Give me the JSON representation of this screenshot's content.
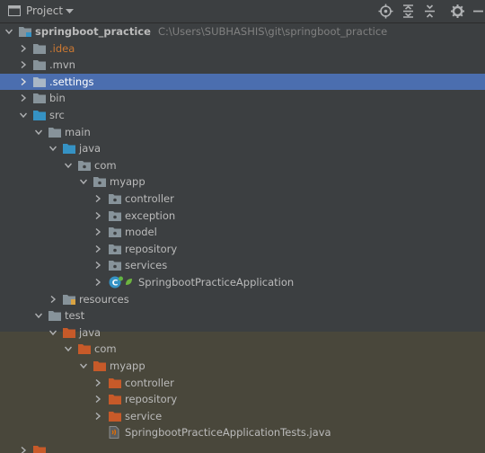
{
  "header": {
    "title": "Project",
    "icons": [
      "project-view-icon",
      "chevron-down-icon",
      "locate-icon",
      "expand-all-icon",
      "collapse-all-icon",
      "gear-icon",
      "hide-icon"
    ]
  },
  "colors": {
    "panel_bg": "#3c3f41",
    "selection": "#4b6eaf",
    "test_bg": "#49473b",
    "folder": "#87939a",
    "source_folder": "#3592c4",
    "test_folder": "#c75a29",
    "excluded_text": "#cc7832"
  },
  "tree": {
    "project": {
      "name": "springboot_practice",
      "path": "C:\\Users\\SUBHASHIS\\git\\springboot_practice"
    },
    "idea": ".idea",
    "mvn": ".mvn",
    "settings": ".settings",
    "bin": "bin",
    "src": "src",
    "main": "main",
    "main_java": "java",
    "main_com": "com",
    "main_myapp": "myapp",
    "controller": "controller",
    "exception": "exception",
    "model": "model",
    "repository": "repository",
    "services": "services",
    "app_class": "SpringbootPracticeApplication",
    "resources": "resources",
    "test": "test",
    "test_java": "java",
    "test_com": "com",
    "test_myapp": "myapp",
    "test_controller": "controller",
    "test_repository": "repository",
    "test_service": "service",
    "test_class": "SpringbootPracticeApplicationTests.java"
  }
}
